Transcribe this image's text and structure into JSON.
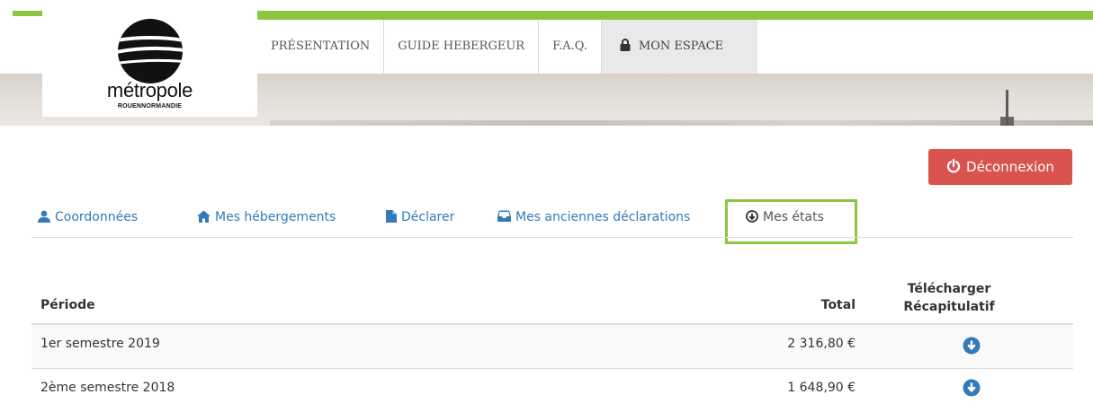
{
  "header": {
    "logo": {
      "name": "métropole",
      "subtitle": "ROUENNORMANDIE"
    },
    "nav": [
      {
        "label": "PRÉSENTATION"
      },
      {
        "label": "GUIDE HEBERGEUR"
      },
      {
        "label": "F.A.Q."
      },
      {
        "label": "MON ESPACE",
        "icon": "lock-icon",
        "active": true
      }
    ]
  },
  "actions": {
    "logout_label": "Déconnexion",
    "logout_icon": "power-icon",
    "logout_color": "#d9534f"
  },
  "tabs": [
    {
      "label": "Coordonnées",
      "icon": "user-icon"
    },
    {
      "label": "Mes hébergements",
      "icon": "home-icon"
    },
    {
      "label": "Déclarer",
      "icon": "file-icon"
    },
    {
      "label": "Mes anciennes déclarations",
      "icon": "inbox-icon"
    },
    {
      "label": "Mes états",
      "icon": "download-circle-icon",
      "active": true
    }
  ],
  "table": {
    "headers": {
      "period": "Période",
      "total": "Total",
      "download_line1": "Télécharger",
      "download_line2": "Récapitulatif"
    },
    "rows": [
      {
        "period": "1er semestre 2019",
        "total": "2 316,80 €"
      },
      {
        "period": "2ème semestre 2018",
        "total": "1 648,90 €"
      }
    ]
  },
  "colors": {
    "accent_green": "#8cc63f",
    "link_blue": "#337ab7",
    "danger_red": "#d9534f"
  }
}
